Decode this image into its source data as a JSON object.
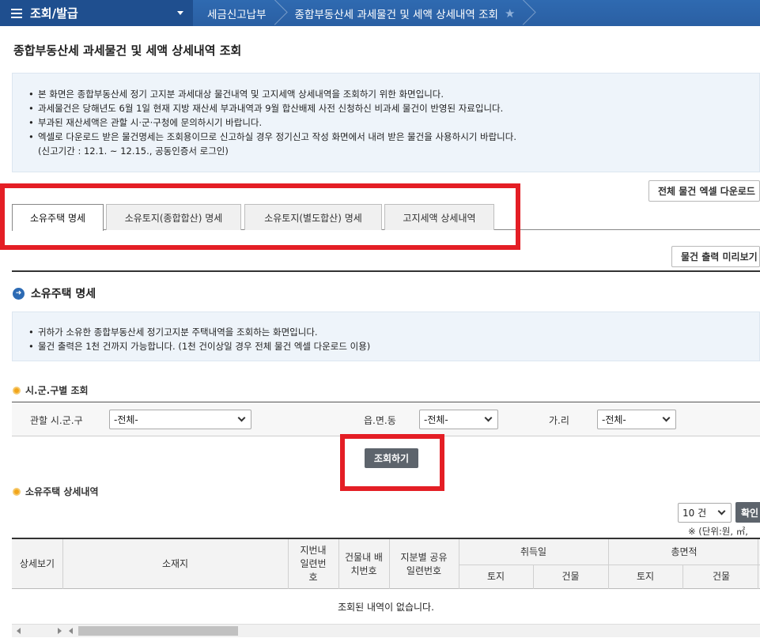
{
  "topbar": {
    "menu_label": "조회/발급",
    "crumbs": [
      "세금신고납부",
      "종합부동산세 과세물건 및 세액 상세내역 조회"
    ]
  },
  "page_title": "종합부동산세 과세물건 및 세액 상세내역 조회",
  "notice": [
    "본 화면은 종합부동산세 정기 고지분 과세대상 물건내역 및 고지세액 상세내역을 조회하기 위한 화면입니다.",
    "과세물건은 당해년도 6월 1일 현재 지방 재산세 부과내역과 9월 합산배제 사전 신청하신 비과세 물건이 반영된 자료입니다.",
    "부과된 재산세액은 관할 시·군·구청에 문의하시기 바랍니다.",
    "엑셀로 다운로드 받은 물건명세는 조회용이므로 신고하실 경우 정기신고 작성 화면에서 내려 받은 물건을 사용하시기 바랍니다."
  ],
  "notice_sub": "(신고기간 : 12.1. ~ 12.15., 공동인증서 로그인)",
  "excel_button": "전체 물건 엑셀 다운로드",
  "tabs": [
    "소유주택 명세",
    "소유토지(종합합산) 명세",
    "소유토지(별도합산) 명세",
    "고지세액 상세내역"
  ],
  "preview_button": "물건 출력 미리보기",
  "section_title": "소유주택 명세",
  "section_notice": [
    "귀하가 소유한 종합부동산세 정기고지분 주택내역을 조회하는 화면입니다.",
    "물건 출력은 1천 건까지 가능합니다. (1천 건이상일 경우 전체 물건 엑셀 다운로드 이용)"
  ],
  "filter": {
    "title": "시.군.구별 조회",
    "sigungu_label": "관할 시.군.구",
    "sigungu_value": "-전체-",
    "eup_label": "읍.면.동",
    "eup_value": "-전체-",
    "ri_label": "가.리",
    "ri_value": "-전체-",
    "search_button": "조회하기"
  },
  "detail": {
    "title": "소유주택 상세내역",
    "page_size": "10 건",
    "confirm_button": "확인",
    "unit_note": "※ (단위:원, ㎡,",
    "headers": {
      "view": "상세보기",
      "location": "소재지",
      "lot_no": "지번내 일련번호",
      "building_no": "건물내 배치번호",
      "share_no": "지분별 공유일련번호",
      "acquire_date": "취득일",
      "total_area": "총면적",
      "land": "토지",
      "building": "건물"
    },
    "empty_message": "조회된 내역이 없습니다."
  },
  "colors": {
    "nav": "#2f6ab1",
    "highlight": "#e41e25",
    "dark_button": "#5d646c"
  }
}
